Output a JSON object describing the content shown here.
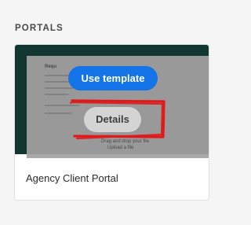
{
  "section": {
    "label": "PORTALS"
  },
  "card": {
    "title": "Agency Client Portal",
    "preview_colors": {
      "background": "#0f3a34",
      "document": "#a9a9a9"
    },
    "preview_snippet": {
      "heading": "Requ",
      "footer_line_1": "Drag and drop your file",
      "footer_line_2": "Upload a file"
    },
    "actions": {
      "use_template_label": "Use template",
      "details_label": "Details"
    }
  },
  "annotation": {
    "color": "#e01a1a",
    "target": "details-button"
  }
}
